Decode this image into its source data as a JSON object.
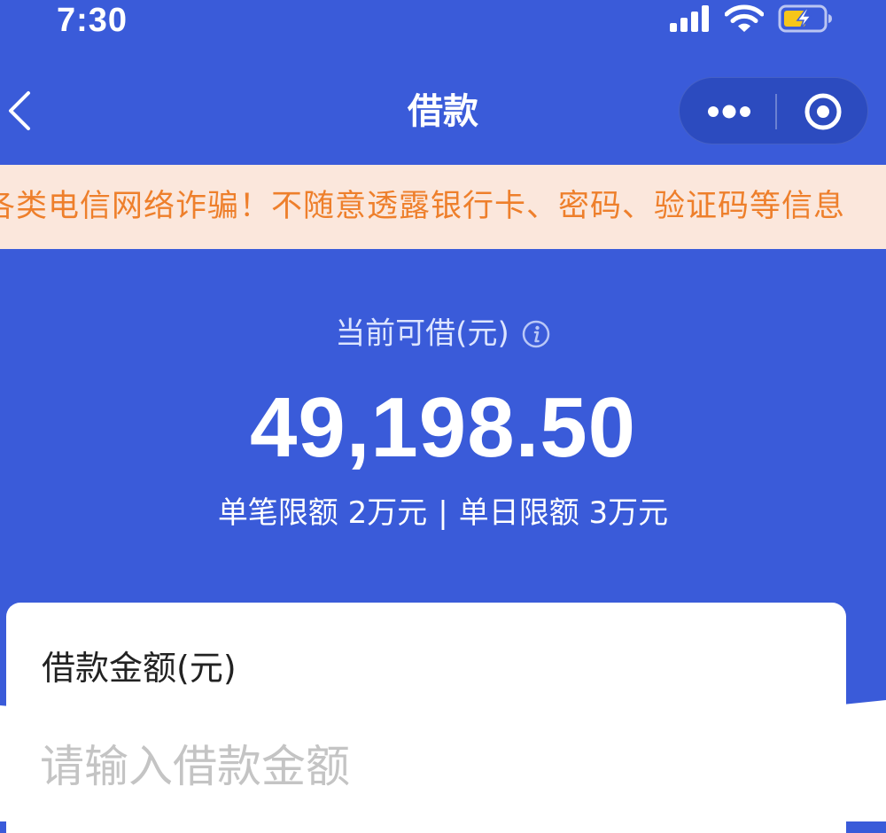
{
  "status_bar": {
    "time": "7:30",
    "icons": [
      "signal-icon",
      "wifi-icon",
      "battery-charging-icon"
    ]
  },
  "nav": {
    "title": "借款",
    "back_icon": "chevron-left-icon",
    "more_icon": "more-dots-icon",
    "close_icon": "target-close-icon"
  },
  "notice": {
    "text": "各类电信网络诈骗！不随意透露银行卡、密码、验证码等信息"
  },
  "available": {
    "label": "当前可借(元)",
    "amount": "49,198.50",
    "info_icon": "info-icon"
  },
  "limits": {
    "single_label": "单笔限额",
    "single_value": "2万元",
    "separator": "|",
    "daily_label": "单日限额",
    "daily_value": "3万元"
  },
  "loan_form": {
    "title": "借款金额(元)",
    "placeholder": "请输入借款金额"
  },
  "colors": {
    "primary_blue": "#3a5bd9",
    "notice_bg": "#fbe7dc",
    "notice_text": "#ee7f2b",
    "battery_fill": "#f6c61a"
  }
}
